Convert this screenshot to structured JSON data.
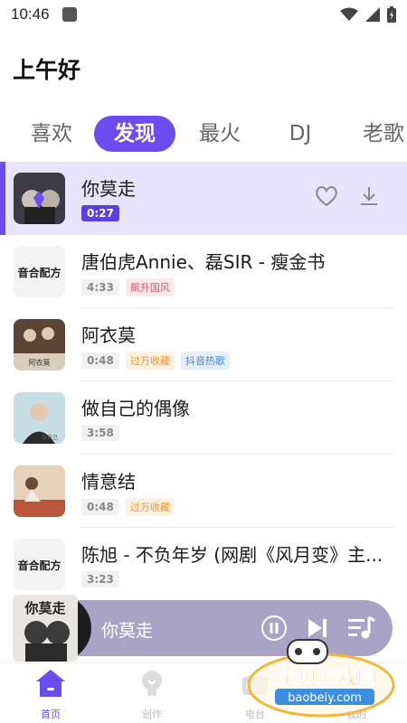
{
  "status": {
    "time": "10:46"
  },
  "greeting": "上午好",
  "tabs": [
    {
      "label": "喜欢",
      "active": false
    },
    {
      "label": "发现",
      "active": true
    },
    {
      "label": "最火",
      "active": false
    },
    {
      "label": "DJ",
      "active": false
    },
    {
      "label": "老歌",
      "active": false
    }
  ],
  "songs": [
    {
      "title": "你莫走",
      "duration": "0:27",
      "tags": [],
      "active": true,
      "cover_label": ""
    },
    {
      "title": "唐伯虎Annie、磊SIR - 瘦金书",
      "duration": "4:33",
      "tags": [
        "飙升国风"
      ],
      "cover_label": "音合配方"
    },
    {
      "title": "阿衣莫",
      "duration": "0:48",
      "tags": [
        "过万收藏",
        "抖音热歌"
      ],
      "cover_label": "阿衣莫"
    },
    {
      "title": "做自己的偶像",
      "duration": "3:58",
      "tags": [],
      "cover_label": "做自己"
    },
    {
      "title": "情意结",
      "duration": "0:48",
      "tags": [
        "过万收藏"
      ],
      "cover_label": ""
    },
    {
      "title": "陈旭 - 不负年岁 (网剧《风月变》主...",
      "duration": "3:23",
      "tags": [],
      "cover_label": "音合配方"
    }
  ],
  "player": {
    "title": "你莫走",
    "cover_text": "你莫走"
  },
  "nav": [
    {
      "label": "首页",
      "icon": "home-icon",
      "active": true
    },
    {
      "label": "创作",
      "icon": "bulb-icon",
      "active": false
    },
    {
      "label": "电台",
      "icon": "radio-icon",
      "active": false
    },
    {
      "label": "我的",
      "icon": "user-icon",
      "active": false
    }
  ],
  "watermark": {
    "title": "宝贝游戏网",
    "url": "baobeiy.com"
  },
  "colors": {
    "accent": "#6a4cf0",
    "player_bg": "#a9a4c6"
  }
}
